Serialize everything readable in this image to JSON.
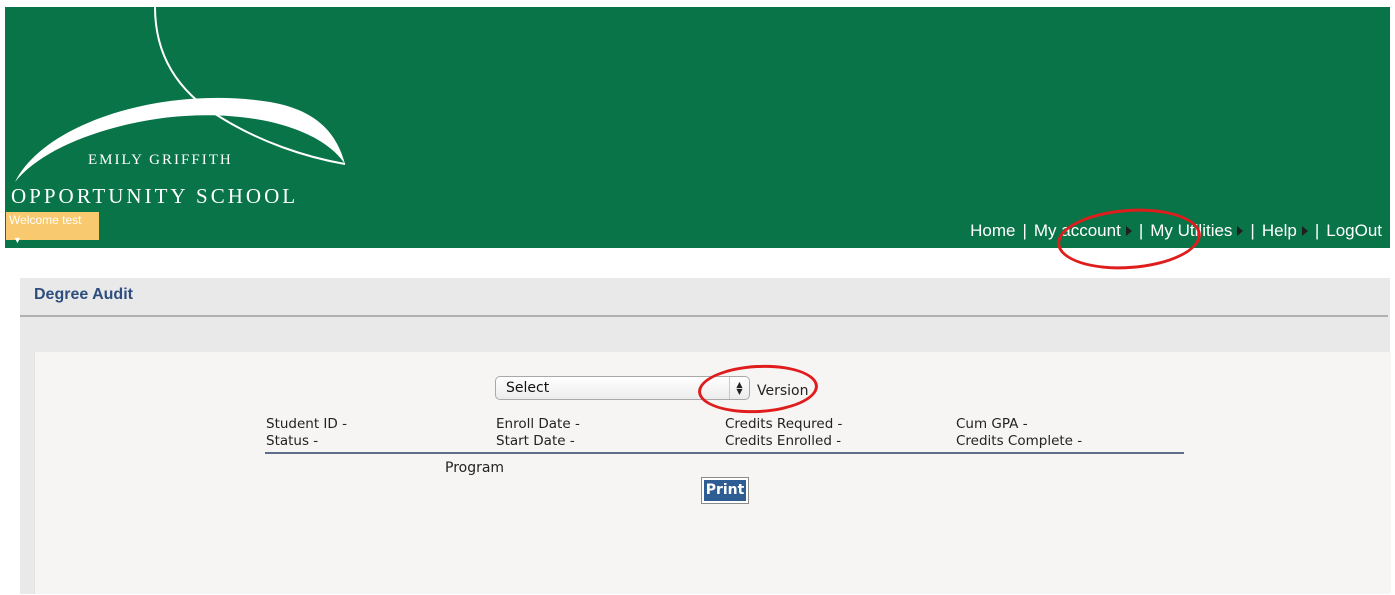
{
  "header": {
    "school_name_line1": "EMILY GRIFFITH",
    "school_name_line2": "OPPORTUNITY SCHOOL",
    "welcome": "Welcome test",
    "nav": {
      "home": "Home",
      "my_account": "My account",
      "my_utilities": "My Utilities",
      "help": "Help",
      "logout": "LogOut",
      "separator": "|"
    },
    "background_color": "#087447"
  },
  "section": {
    "title": "Degree Audit"
  },
  "form": {
    "program_label": "Program",
    "program_select_value": "Select",
    "version_label": "Version"
  },
  "info": {
    "student_id": "Student ID -",
    "status": "Status -",
    "enroll_date": "Enroll Date -",
    "start_date": "Start Date -",
    "credits_required": "Credits Requred -",
    "credits_enrolled": "Credits Enrolled -",
    "cum_gpa": "Cum GPA -",
    "credits_complete": "Credits Complete -"
  },
  "buttons": {
    "print": "Print"
  },
  "colors": {
    "header_green": "#087447",
    "title_blue": "#2e4e7e",
    "button_blue": "#2e5d93",
    "highlight_red": "#e01d1d",
    "welcome_orange": "#f8c96e"
  }
}
